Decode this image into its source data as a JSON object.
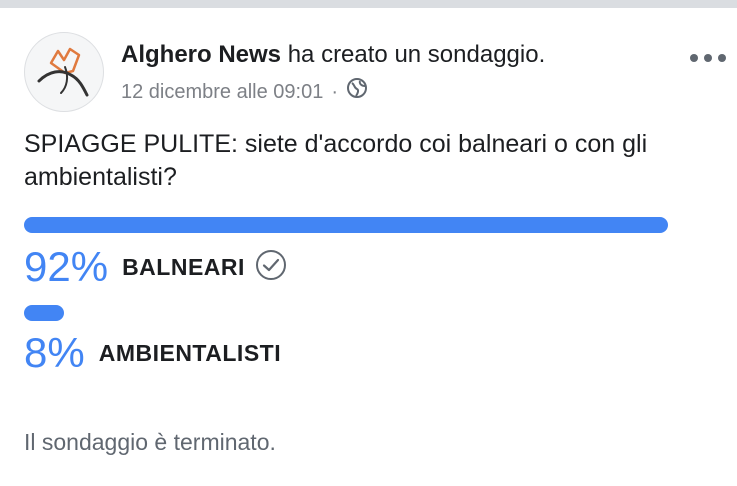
{
  "post": {
    "author": "Alghero News",
    "action": "ha creato un sondaggio.",
    "timestamp": "12 dicembre alle 09:01",
    "separator": "·",
    "privacy_icon": "globe-icon",
    "more_icon": "more-horizontal-icon",
    "avatar_icon": "alghero-news-logo"
  },
  "poll": {
    "question": "SPIAGGE PULITE: siete d'accordo coi balneari o con gli ambientalisti?",
    "options": [
      {
        "percent_label": "92%",
        "label": "BALNEARI",
        "value": 0.92,
        "selected": true
      },
      {
        "percent_label": "8%",
        "label": "AMBIENTALISTI",
        "value": 0.08,
        "selected": false
      }
    ],
    "status": "Il sondaggio è terminato."
  },
  "colors": {
    "accent": "#4285f4",
    "text": "#1c1e21",
    "secondary": "#7d8086"
  }
}
